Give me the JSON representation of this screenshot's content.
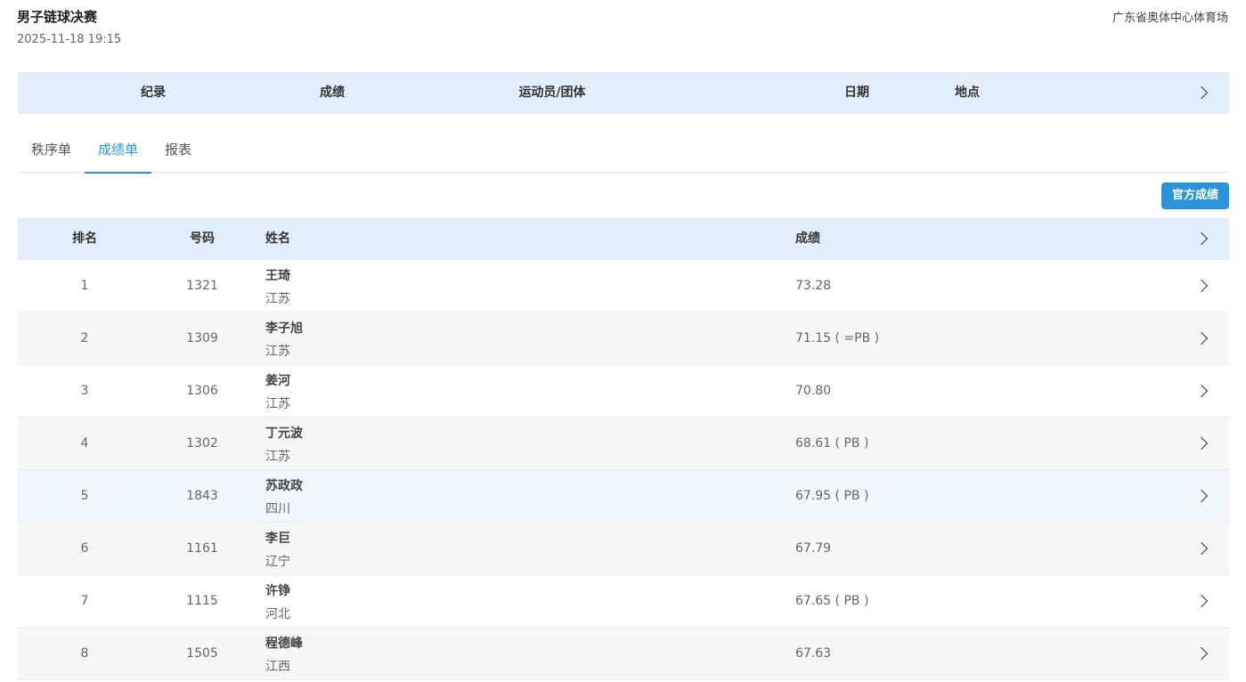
{
  "header": {
    "title": "男子链球决赛",
    "datetime": "2025-11-18 19:15",
    "venue": "广东省奥体中心体育场"
  },
  "record_bar": {
    "columns": [
      "纪录",
      "成绩",
      "运动员/团体",
      "日期",
      "地点"
    ]
  },
  "tabs": [
    {
      "label": "秩序单",
      "active": false
    },
    {
      "label": "成绩单",
      "active": true
    },
    {
      "label": "报表",
      "active": false
    }
  ],
  "official_button": "官方成绩",
  "table": {
    "headers": [
      "排名",
      "号码",
      "姓名",
      "成绩"
    ],
    "rows": [
      {
        "rank": "1",
        "bib": "1321",
        "name": "王琦",
        "team": "江苏",
        "result": "73.28"
      },
      {
        "rank": "2",
        "bib": "1309",
        "name": "李子旭",
        "team": "江苏",
        "result": "71.15 ( =PB )"
      },
      {
        "rank": "3",
        "bib": "1306",
        "name": "姜河",
        "team": "江苏",
        "result": "70.80"
      },
      {
        "rank": "4",
        "bib": "1302",
        "name": "丁元波",
        "team": "江苏",
        "result": "68.61 ( PB )"
      },
      {
        "rank": "5",
        "bib": "1843",
        "name": "苏政政",
        "team": "四川",
        "result": "67.95 ( PB )"
      },
      {
        "rank": "6",
        "bib": "1161",
        "name": "李巨",
        "team": "辽宁",
        "result": "67.79"
      },
      {
        "rank": "7",
        "bib": "1115",
        "name": "许铮",
        "team": "河北",
        "result": "67.65 ( PB )"
      },
      {
        "rank": "8",
        "bib": "1505",
        "name": "程德峰",
        "team": "江西",
        "result": "67.63"
      }
    ]
  },
  "colors": {
    "accent": "#2b94d8",
    "header_band": "#e2eefc",
    "row_alt": "#f7f7f7",
    "row_highlight": "#f1f7fd"
  },
  "icons": {
    "row_chevron": "chevron-right-icon"
  }
}
